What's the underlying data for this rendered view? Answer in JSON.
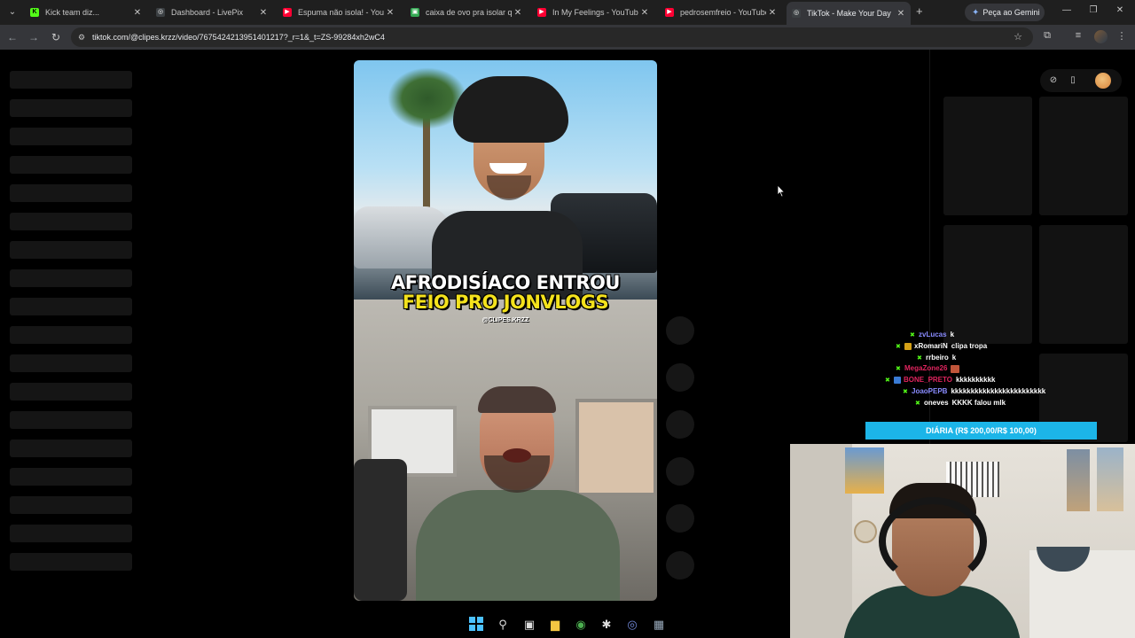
{
  "browser": {
    "tabs": [
      {
        "title": "Kick team diz...",
        "favicon_color": "#53fc18",
        "favicon_glyph": "K"
      },
      {
        "title": "Dashboard - LivePix",
        "favicon_color": "#e8eaed",
        "favicon_glyph": "◎"
      },
      {
        "title": "Espuma não isola! - YouTub",
        "favicon_color": "#ff0033",
        "favicon_glyph": "▶"
      },
      {
        "title": "caixa de ovo pra isolar qua",
        "favicon_color": "#34a853",
        "favicon_glyph": "▣"
      },
      {
        "title": "In My Feelings - YouTube",
        "favicon_color": "#ff0033",
        "favicon_glyph": "▶"
      },
      {
        "title": "pedrosemfreio - YouTube",
        "favicon_color": "#ff0033",
        "favicon_glyph": "▶"
      },
      {
        "title": "TikTok - Make Your Day",
        "favicon_color": "#e8eaed",
        "favicon_glyph": "◎"
      }
    ],
    "gemini_label": "Peça ao Gemini",
    "url": "tiktok.com/@clipes.krzz/video/7675424213951401217?_r=1&_t=ZS-99284xh2wC4"
  },
  "video": {
    "caption_line1": "AFRODISÍACO ENTROU",
    "caption_line2": "FEIO PRO JONVLOGS",
    "handle": "@CLIPES.KRZZ"
  },
  "chat": {
    "messages": [
      {
        "user": "zvLucas",
        "text": "k",
        "color": "#8a8cff"
      },
      {
        "user": "xRomariN",
        "text": "clipa tropa",
        "color": "#ffffff"
      },
      {
        "user": "rrbeiro",
        "text": "k",
        "color": "#ffffff"
      },
      {
        "user": "MegaZone26",
        "text": "",
        "color": "#e0245e"
      },
      {
        "user": "BONE_PRETO",
        "text": "kkkkkkkkkk",
        "color": "#e0245e"
      },
      {
        "user": "JoaoPEPB",
        "text": "kkkkkkkkkkkkkkkkkkkkkkkk",
        "color": "#8a8cff"
      },
      {
        "user": "oneves",
        "text": "KKKK falou mlk",
        "color": "#ffffff"
      }
    ]
  },
  "goal": {
    "label": "DIÁRIA (R$ 200,00/R$ 100,00)"
  }
}
